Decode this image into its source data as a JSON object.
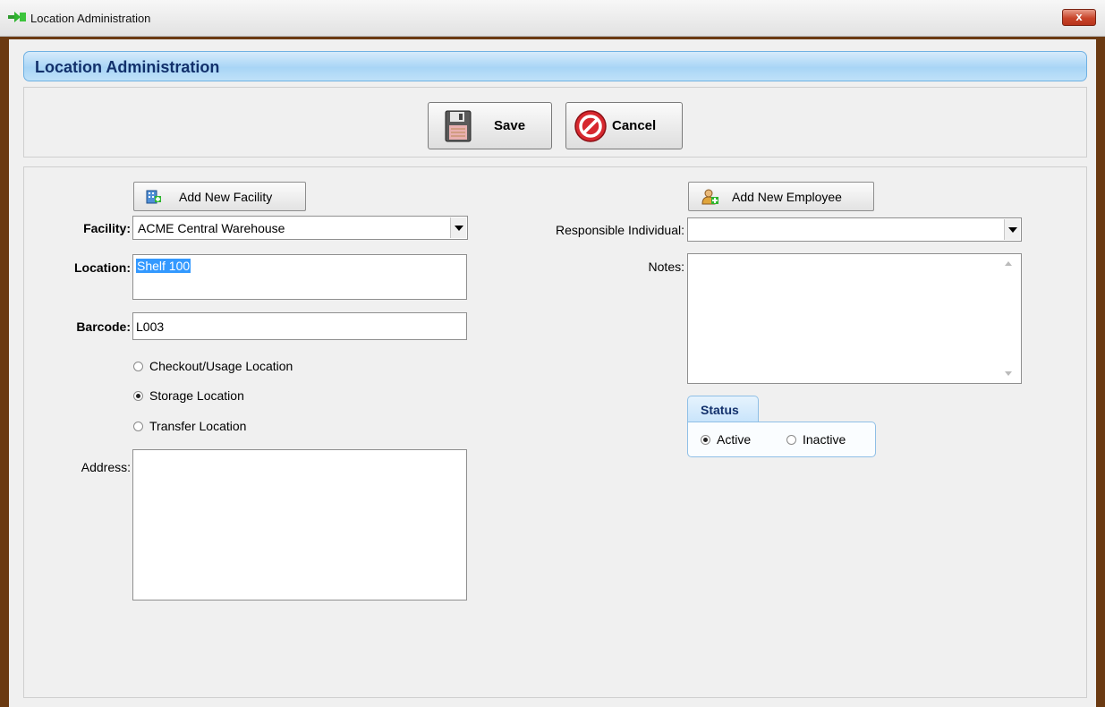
{
  "window": {
    "title": "Location Administration",
    "close_label": "x"
  },
  "header": {
    "title": "Location Administration"
  },
  "toolbar": {
    "save_label": "Save",
    "cancel_label": "Cancel"
  },
  "form": {
    "add_facility_label": "Add New Facility",
    "facility_label": "Facility:",
    "facility_value": "ACME Central Warehouse",
    "location_label": "Location:",
    "location_value": "Shelf 100",
    "barcode_label": "Barcode:",
    "barcode_value": "L003",
    "location_types": [
      {
        "label": "Checkout/Usage Location",
        "selected": false
      },
      {
        "label": "Storage Location",
        "selected": true
      },
      {
        "label": "Transfer Location",
        "selected": false
      }
    ],
    "address_label": "Address:",
    "address_value": "",
    "add_employee_label": "Add New Employee",
    "responsible_label": "Responsible Individual:",
    "responsible_value": "",
    "notes_label": "Notes:",
    "notes_value": "",
    "status": {
      "title": "Status",
      "options": [
        {
          "label": "Active",
          "selected": true
        },
        {
          "label": "Inactive",
          "selected": false
        }
      ]
    }
  },
  "colors": {
    "window_frame": "#6b3a12",
    "header_text": "#12306b",
    "header_gradient": "#a8d5f6",
    "selection": "#3399ff",
    "cancel_red": "#d7282f"
  },
  "icons": [
    "app-icon",
    "close-icon",
    "floppy-disk-icon",
    "cancel-icon",
    "facility-icon",
    "employee-icon",
    "dropdown-arrow-icon"
  ]
}
